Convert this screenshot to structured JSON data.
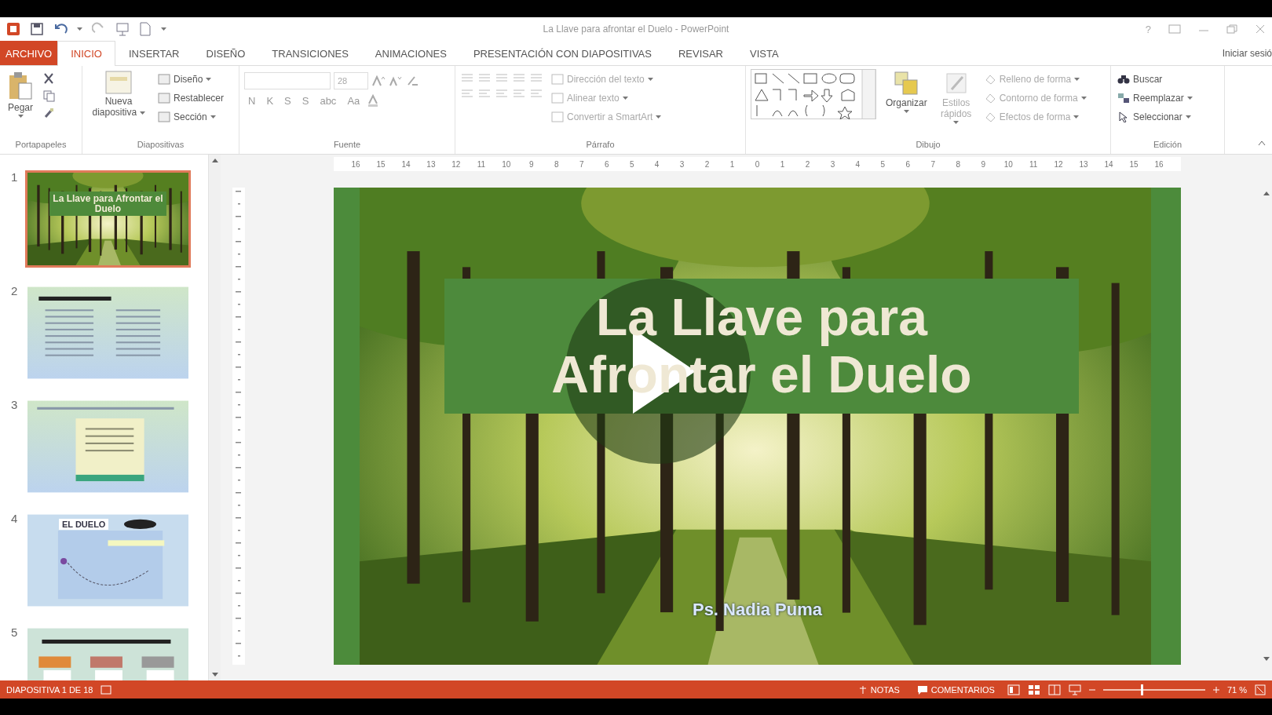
{
  "window": {
    "title": "La Llave para afrontar el Duelo - PowerPoint",
    "help": "?",
    "sign_in": "Iniciar sesió"
  },
  "tabs": [
    {
      "label": "ARCHIVO",
      "kind": "file",
      "selected": false
    },
    {
      "label": "INICIO",
      "kind": "tab",
      "selected": true
    },
    {
      "label": "INSERTAR",
      "kind": "tab",
      "selected": false
    },
    {
      "label": "DISEÑO",
      "kind": "tab",
      "selected": false
    },
    {
      "label": "TRANSICIONES",
      "kind": "tab",
      "selected": false
    },
    {
      "label": "ANIMACIONES",
      "kind": "tab",
      "selected": false
    },
    {
      "label": "PRESENTACIÓN CON DIAPOSITIVAS",
      "kind": "tab",
      "selected": false
    },
    {
      "label": "REVISAR",
      "kind": "tab",
      "selected": false
    },
    {
      "label": "VISTA",
      "kind": "tab",
      "selected": false
    }
  ],
  "ribbon": {
    "groups": [
      {
        "kind": "clipboard",
        "label": "Portapapeles",
        "buttons": [
          {
            "label": "Pegar"
          }
        ]
      },
      {
        "kind": "slides",
        "label": "Diapositivas",
        "buttons": [
          {
            "label": "Nueva diapositiva"
          },
          {
            "label": "Diseño"
          },
          {
            "label": "Restablecer"
          },
          {
            "label": "Sección"
          }
        ]
      },
      {
        "kind": "font",
        "label": "Fuente",
        "font_size": "28",
        "buttons": [
          {
            "label": "N"
          },
          {
            "label": "K"
          },
          {
            "label": "S"
          },
          {
            "label": "S"
          },
          {
            "label": "abc"
          },
          {
            "label": "Aa"
          }
        ]
      },
      {
        "kind": "paragraph",
        "label": "Párrafo",
        "buttons": [
          {
            "label": "Dirección del texto",
            "disabled": true
          },
          {
            "label": "Alinear texto",
            "disabled": true
          },
          {
            "label": "Convertir a SmartArt",
            "disabled": true
          }
        ]
      },
      {
        "kind": "drawing",
        "label": "Dibujo",
        "buttons": [
          {
            "label": "Organizar",
            "disabled": false
          },
          {
            "label": "Estilos rápidos",
            "disabled": true
          },
          {
            "label": "Relleno de forma",
            "disabled": true
          },
          {
            "label": "Contorno de forma",
            "disabled": true
          },
          {
            "label": "Efectos de forma",
            "disabled": true
          }
        ]
      },
      {
        "kind": "editing",
        "label": "Edición",
        "buttons": [
          {
            "label": "Buscar"
          },
          {
            "label": "Reemplazar"
          },
          {
            "label": "Seleccionar"
          }
        ]
      }
    ]
  },
  "ruler": {
    "numbers": [
      "16",
      "15",
      "14",
      "13",
      "12",
      "11",
      "10",
      "9",
      "8",
      "7",
      "6",
      "5",
      "4",
      "3",
      "2",
      "1",
      "0",
      "1",
      "2",
      "3",
      "4",
      "5",
      "6",
      "7",
      "8",
      "9",
      "10",
      "11",
      "12",
      "13",
      "14",
      "15",
      "16"
    ]
  },
  "thumbnails": [
    {
      "number": "1",
      "kind": "forest",
      "title": "La Llave para Afrontar el Duelo",
      "selected": true
    },
    {
      "number": "2",
      "kind": "text",
      "selected": false
    },
    {
      "number": "3",
      "kind": "quote",
      "selected": false
    },
    {
      "number": "4",
      "kind": "diagram",
      "title": "EL DUELO",
      "selected": false
    },
    {
      "number": "5",
      "kind": "flow",
      "selected": false
    }
  ],
  "slide": {
    "title_lines": [
      "La Llave para",
      "Afrontar el Duelo"
    ],
    "subtitle": "Ps. Nadia Puma"
  },
  "status_bar": {
    "slide_info": "DIAPOSITIVA 1 DE 18",
    "notes": "NOTAS",
    "comments": "COMENTARIOS",
    "zoom": "71 %",
    "zoom_slider": {
      "level": 0.38
    }
  }
}
